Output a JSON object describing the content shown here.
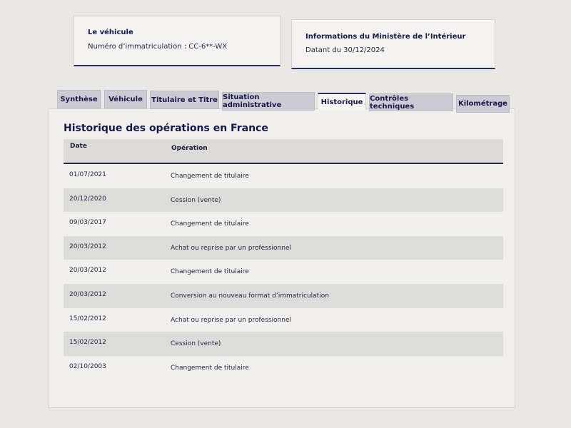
{
  "vehicle_card": {
    "title": "Le véhicule",
    "plate_text": "Numéro d’immatriculation : CC-6**-WX"
  },
  "ministry_card": {
    "title": "Informations du Ministère de l’Intérieur",
    "date_text": "Datant du 30/12/2024"
  },
  "tabs": [
    {
      "label": "Synthèse",
      "active": false
    },
    {
      "label": "Véhicule",
      "active": false
    },
    {
      "label": "Titulaire et Titre",
      "active": false
    },
    {
      "label": "Situation administrative",
      "active": false
    },
    {
      "label": "Historique",
      "active": true
    },
    {
      "label": "Contrôles techniques",
      "active": false
    },
    {
      "label": "Kilométrage",
      "active": false
    }
  ],
  "history": {
    "title": "Historique des opérations en France",
    "headers": {
      "date": "Date",
      "operation": "Opération"
    },
    "rows": [
      {
        "date": "01/07/2021",
        "operation": "Changement de titulaire"
      },
      {
        "date": "20/12/2020",
        "operation": "Cession (vente)"
      },
      {
        "date": "09/03/2017",
        "operation": "Changement de titulaire"
      },
      {
        "date": "20/03/2012",
        "operation": "Achat ou reprise par un professionnel"
      },
      {
        "date": "20/03/2012",
        "operation": "Changement de titulaire"
      },
      {
        "date": "20/03/2012",
        "operation": "Conversion au nouveau format d’immatriculation"
      },
      {
        "date": "15/02/2012",
        "operation": "Achat ou reprise par un professionnel"
      },
      {
        "date": "15/02/2012",
        "operation": "Cession (vente)"
      },
      {
        "date": "02/10/2003",
        "operation": "Changement de titulaire"
      }
    ]
  }
}
